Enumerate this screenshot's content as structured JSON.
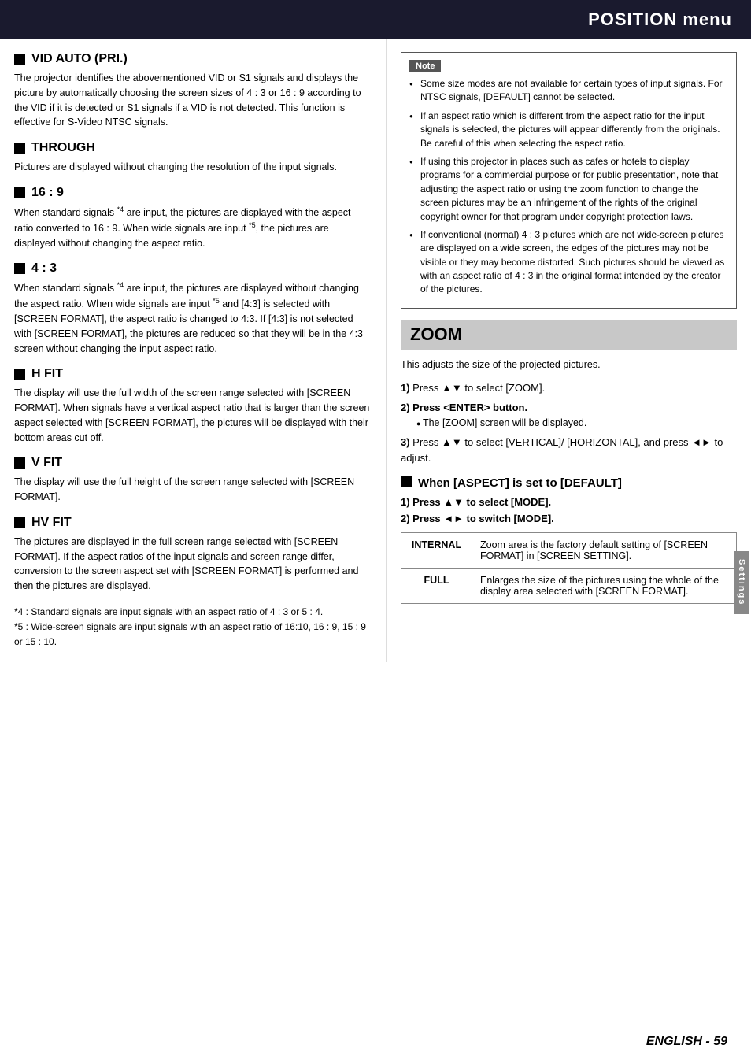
{
  "header": {
    "title": "POSITION menu"
  },
  "left_column": {
    "sections": [
      {
        "id": "vid-auto",
        "title": "VID AUTO (PRI.)",
        "body": "The projector identifies the abovementioned VID or S1 signals and displays the picture by automatically choosing the screen sizes of 4 : 3 or 16 : 9 according to the VID if it is detected or S1 signals if a VID is not detected. This function is effective for S-Video NTSC signals."
      },
      {
        "id": "through",
        "title": "THROUGH",
        "body": "Pictures are displayed without changing the resolution of the input signals."
      },
      {
        "id": "16-9",
        "title": "16 : 9",
        "body": "When standard signals *4 are input, the pictures are displayed with the aspect ratio converted to 16 : 9. When wide signals are input *5, the pictures are displayed without changing the aspect ratio."
      },
      {
        "id": "4-3",
        "title": "4 : 3",
        "body": "When standard signals *4 are input, the pictures are displayed without changing the aspect ratio. When wide signals are input *5 and [4:3] is selected with [SCREEN FORMAT], the aspect ratio is changed to 4:3. If [4:3] is not selected with [SCREEN FORMAT], the pictures are reduced so that they will be in the 4:3 screen without changing the input aspect ratio."
      },
      {
        "id": "h-fit",
        "title": "H FIT",
        "body": "The display will use the full width of the screen range selected with [SCREEN FORMAT]. When signals have a vertical aspect ratio that is larger than the screen aspect selected with [SCREEN FORMAT], the pictures will be displayed with their bottom areas cut off."
      },
      {
        "id": "v-fit",
        "title": "V FIT",
        "body": "The display will use the full height of the screen range selected with [SCREEN FORMAT]."
      },
      {
        "id": "hv-fit",
        "title": "HV FIT",
        "body": "The pictures are displayed in the full screen range selected with [SCREEN FORMAT]. If the aspect ratios of the input signals and screen range differ, conversion to the screen aspect set with [SCREEN FORMAT] is performed and then the pictures are displayed."
      }
    ],
    "footnotes": [
      "*4 :   Standard signals are input signals with an aspect ratio of 4 : 3 or 5 : 4.",
      "*5 :   Wide-screen signals are input signals with an aspect ratio of 16:10, 16 : 9, 15 : 9 or 15 : 10."
    ]
  },
  "right_column": {
    "note": {
      "label": "Note",
      "items": [
        "Some size modes are not available for certain types of input signals. For NTSC signals, [DEFAULT] cannot be selected.",
        "If an aspect ratio which is different from the aspect ratio for the input signals is selected, the pictures will appear differently from the originals. Be careful of this when selecting the aspect ratio.",
        "If using this projector in places such as cafes or hotels to display programs for a commercial purpose or for public presentation, note that adjusting the aspect ratio or using the zoom function to change the screen pictures may be an infringement of the rights of the original copyright owner for that program under copyright protection laws.",
        "If conventional (normal) 4 : 3 pictures which are not wide-screen pictures are displayed on a wide screen, the edges of the pictures may not be visible or they may become distorted. Such pictures should be viewed as with an aspect ratio of 4 : 3 in the original format intended by the creator of the pictures."
      ]
    },
    "zoom": {
      "title": "ZOOM",
      "intro": "This adjusts the size of the projected pictures.",
      "steps": [
        {
          "num": "1)",
          "text": "Press ▲▼ to select [ZOOM]."
        },
        {
          "num": "2)",
          "text": "Press <ENTER> button.",
          "sub": "The [ZOOM] screen will be displayed."
        },
        {
          "num": "3)",
          "text": "Press ▲▼ to select [VERTICAL]/ [HORIZONTAL], and press ◄► to adjust."
        }
      ],
      "aspect_section": {
        "title": "When [ASPECT] is set to [DEFAULT]",
        "steps": [
          {
            "num": "1)",
            "text": "Press ▲▼ to select [MODE]."
          },
          {
            "num": "2)",
            "text": "Press ◄► to switch [MODE]."
          }
        ],
        "table": [
          {
            "label": "INTERNAL",
            "description": "Zoom area is the factory default setting of [SCREEN FORMAT] in [SCREEN SETTING]."
          },
          {
            "label": "FULL",
            "description": "Enlarges the size of the pictures using the whole of the display area selected with [SCREEN FORMAT]."
          }
        ]
      }
    }
  },
  "side_tab": {
    "label": "Settings"
  },
  "footer": {
    "page_text": "ENGLISH - 59"
  }
}
